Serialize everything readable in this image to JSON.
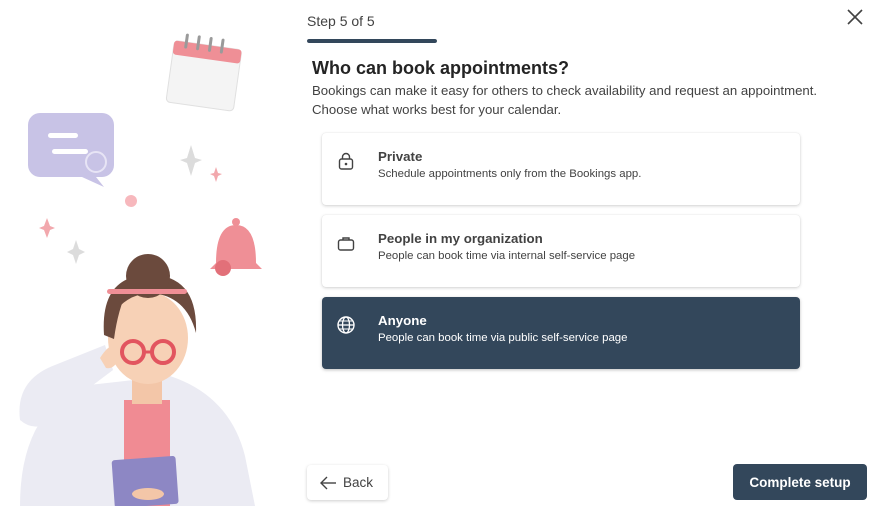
{
  "wizard": {
    "step_label": "Step 5 of 5",
    "progress": 1.0
  },
  "dialog": {
    "title": "Who can book appointments?",
    "description": "Bookings can make it easy for others to check availability and request an appointment. Choose what works best for your calendar."
  },
  "options": [
    {
      "icon": "lock-icon",
      "title": "Private",
      "subtitle": "Schedule appointments only from the Bookings app.",
      "selected": false
    },
    {
      "icon": "briefcase-icon",
      "title": "People in my organization",
      "subtitle": "People can book time via internal self-service page",
      "selected": false
    },
    {
      "icon": "globe-icon",
      "title": "Anyone",
      "subtitle": "People can book time via public self-service page",
      "selected": true
    }
  ],
  "footer": {
    "back_label": "Back",
    "complete_label": "Complete setup"
  },
  "colors": {
    "accent": "#33475b",
    "illustration_pink": "#ef8f96",
    "illustration_lavender": "#c8c3e6"
  }
}
